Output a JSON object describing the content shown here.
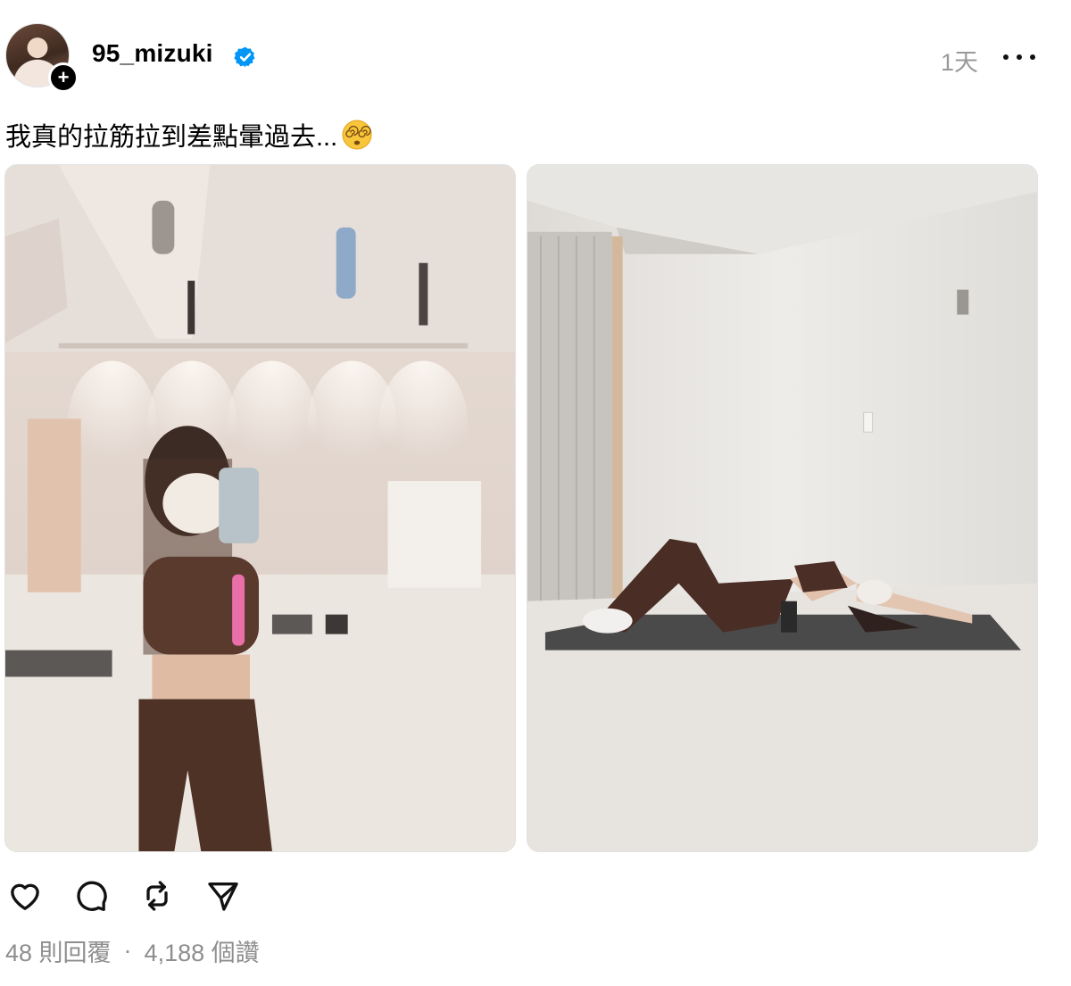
{
  "post": {
    "username": "95_mizuki",
    "verified": true,
    "time_ago": "1天",
    "caption": "我真的拉筋拉到差點暈過去...",
    "caption_emoji": "face-with-spiral-eyes-emoji",
    "images": [
      {
        "description_icon": "gym-mirror-selfie-photo"
      },
      {
        "description_icon": "backbend-stretch-on-mat-photo"
      }
    ],
    "actions": {
      "like_icon": "heart-icon",
      "reply_icon": "comment-bubble-icon",
      "repost_icon": "repost-icon",
      "share_icon": "send-icon"
    },
    "stats": {
      "replies": "48 則回覆",
      "separator": "·",
      "likes": "4,188 個讚"
    }
  },
  "colors": {
    "verified_blue": "#0095f6",
    "muted_text": "#8e8e8e",
    "text": "#000000"
  }
}
